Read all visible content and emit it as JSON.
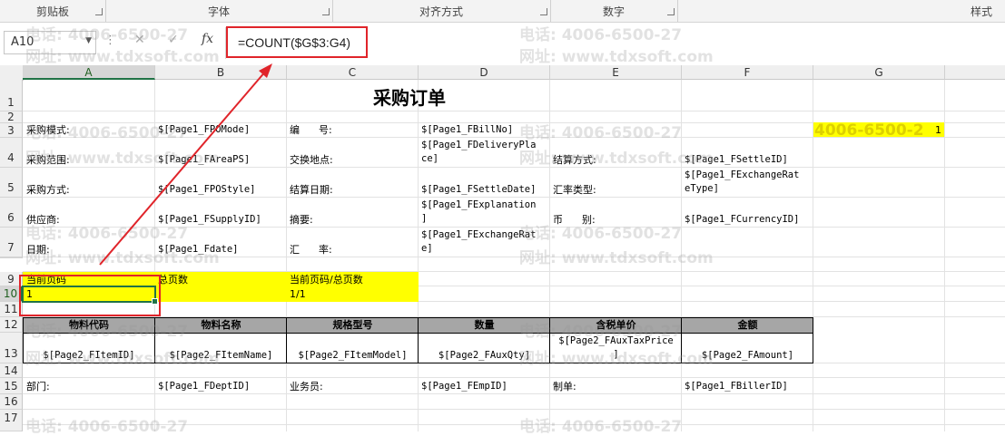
{
  "ribbon": {
    "groups": [
      {
        "label": "剪贴板"
      },
      {
        "label": "字体"
      },
      {
        "label": "对齐方式"
      },
      {
        "label": "数字"
      },
      {
        "label": "样式"
      }
    ]
  },
  "formula_bar": {
    "name_box": "A10",
    "fx_label": "fx",
    "formula": "=COUNT($G$3:G4)"
  },
  "columns": [
    "A",
    "B",
    "C",
    "D",
    "E",
    "F",
    "G"
  ],
  "rows": [
    "1",
    "2",
    "3",
    "4",
    "5",
    "6",
    "7",
    "9",
    "10",
    "11",
    "12",
    "13",
    "14",
    "15",
    "16",
    "17"
  ],
  "sheet": {
    "title": "采购订单",
    "r3": {
      "a": "采购模式:",
      "b": "$[Page1_FPOMode]",
      "c": "编      号:",
      "d": "$[Page1_FBillNo]",
      "g": "1"
    },
    "r4": {
      "a": "采购范围:",
      "b": "$[Page1_FAreaPS]",
      "c": "交换地点:",
      "d": "$[Page1_FDeliveryPla\nce]",
      "e": "结算方式:",
      "f": "$[Page1_FSettleID]"
    },
    "r5": {
      "a": "采购方式:",
      "b": "$[Page1_FPOStyle]",
      "c": "结算日期:",
      "d": "$[Page1_FSettleDate]",
      "e": "汇率类型:",
      "f": "$[Page1_FExchangeRat\neType]"
    },
    "r6": {
      "a": "供应商:",
      "b": "$[Page1_FSupplyID]",
      "c": "摘要:",
      "d": "$[Page1_FExplanation\n]",
      "e": "币      别:",
      "f": "$[Page1_FCurrencyID]"
    },
    "r7": {
      "a": "日期:",
      "b": "$[Page1_Fdate]",
      "c": "汇      率:",
      "d": "$[Page1_FExchangeRat\ne]"
    },
    "r9": {
      "a": "当前页码",
      "b": "总页数",
      "c": "当前页码/总页数"
    },
    "r10": {
      "a": "1",
      "c": "1/1"
    },
    "r12": [
      "物料代码",
      "物料名称",
      "规格型号",
      "数量",
      "含税单价",
      "金额"
    ],
    "r13": [
      "$[Page2_FItemID]",
      "$[Page2_FItemName]",
      "$[Page2_FItemModel]",
      "$[Page2_FAuxQty]",
      "$[Page2_FAuxTaxPrice\n]",
      "$[Page2_FAmount]"
    ],
    "r15": {
      "a": "部门:",
      "b": "$[Page1_FDeptID]",
      "c": "业务员:",
      "d": "$[Page1_FEmpID]",
      "e": "制单:",
      "f": "$[Page1_FBillerID]"
    }
  },
  "watermark": {
    "phone": "电话: 4006-6500-27",
    "phone_cell": "4006-6500-2",
    "site": "网址: www.tdxsoft.com"
  },
  "colors": {
    "accent": "#217346",
    "highlight": "#ffff00",
    "annotation": "#e0242a",
    "header_fill": "#a6a6a6"
  }
}
